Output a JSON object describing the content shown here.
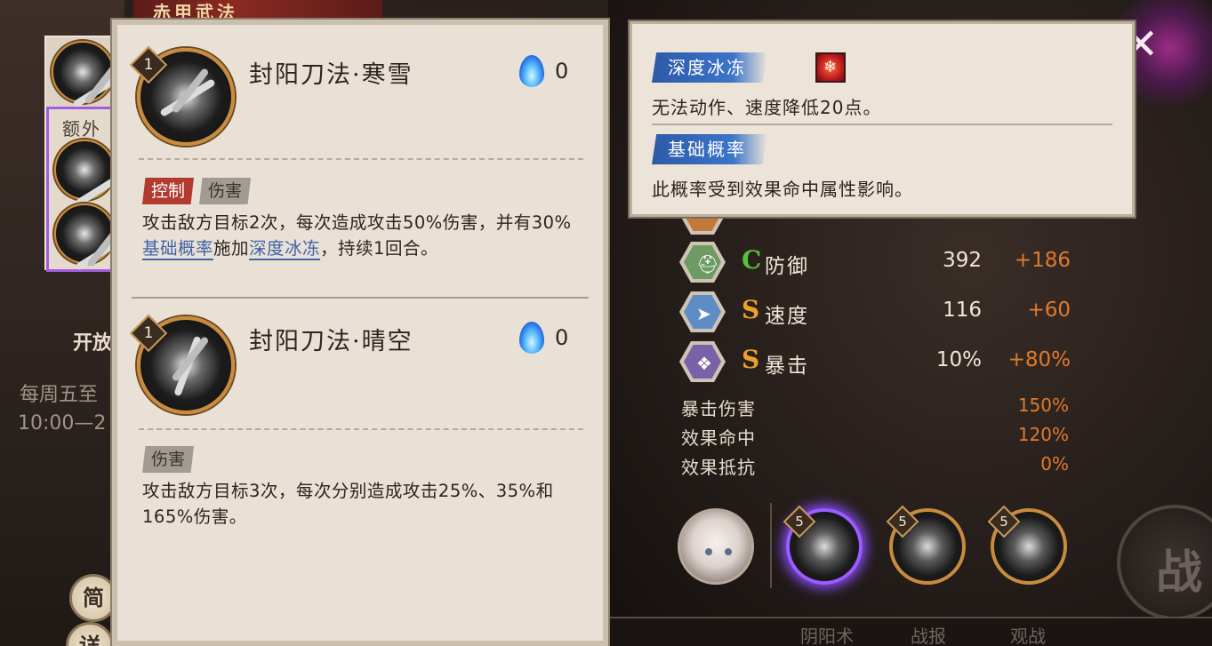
{
  "background": {
    "banner_text": "赤甲武法",
    "event_title": "开放",
    "event_weekday": "每周五至",
    "event_time": "10:00—2",
    "battle_button": "战",
    "bottom_tabs": [
      "阴阳术",
      "战报",
      "观战"
    ]
  },
  "left_column": {
    "extra_label": "额外",
    "simple_button": "简",
    "detail_button": "详"
  },
  "skills": [
    {
      "level": "1",
      "name": "封阳刀法·寒雪",
      "cost": "0",
      "tags": [
        "控制",
        "伤害"
      ],
      "desc_part1": "攻击敌方目标2次，每次造成攻击50%伤害，并有30%",
      "desc_kw1": "基础概率",
      "desc_part2": "施加",
      "desc_kw2": "深度冰冻",
      "desc_part3": "，持续1回合。"
    },
    {
      "level": "1",
      "name": "封阳刀法·晴空",
      "cost": "0",
      "tags": [
        "伤害"
      ],
      "desc": "攻击敌方目标3次，每次分别造成攻击25%、35%和165%伤害。"
    }
  ],
  "tooltip": {
    "title1": "深度冰冻",
    "text1": "无法动作、速度降低20点。",
    "title2": "基础概率",
    "text2": "此概率受到效果命中属性影响。"
  },
  "stats": [
    {
      "name": "防御",
      "grade": "C",
      "value": "392",
      "bonus": "+186",
      "icon": "helmet-icon",
      "color": "#6e9a63"
    },
    {
      "name": "速度",
      "grade": "S",
      "value": "116",
      "bonus": "+60",
      "icon": "arrow-icon",
      "color": "#5e8dc6"
    },
    {
      "name": "暴击",
      "grade": "S",
      "value": "10%",
      "bonus": "+80%",
      "icon": "scroll-icon",
      "color": "#7a62a8"
    }
  ],
  "sub_stats": [
    {
      "name": "暴击伤害",
      "value": "150%"
    },
    {
      "name": "效果命中",
      "value": "120%"
    },
    {
      "name": "效果抵抗",
      "value": "0%"
    }
  ],
  "team_levels": [
    "5",
    "5",
    "5"
  ],
  "colors": {
    "accent_orange": "#e07a2b",
    "keyword_blue": "#3f64a8",
    "control_red": "#b23a2e",
    "select_purple": "#9c5cff"
  }
}
